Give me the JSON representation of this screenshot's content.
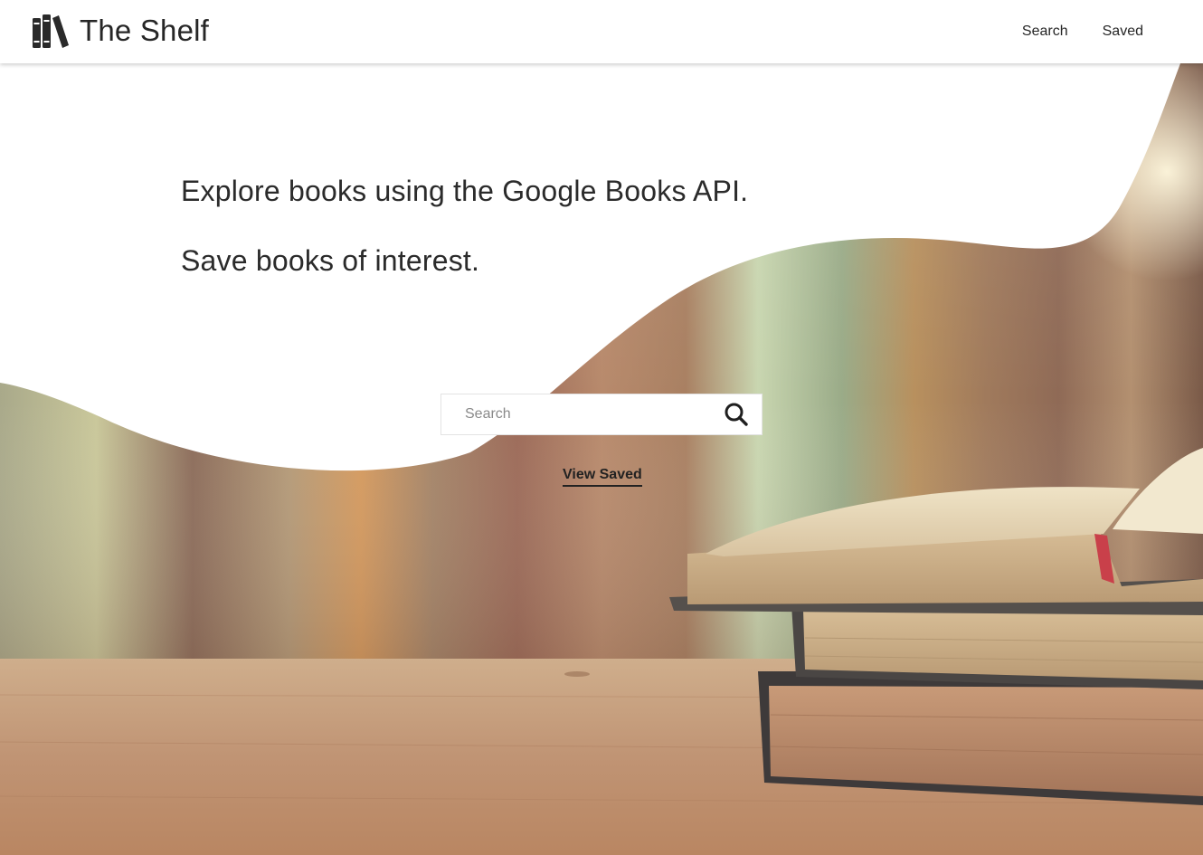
{
  "header": {
    "app_title": "The Shelf",
    "logo_icon": "bookshelf-icon",
    "nav": [
      {
        "label": "Search"
      },
      {
        "label": "Saved"
      }
    ]
  },
  "hero": {
    "headline": "Explore books using the Google Books API.",
    "subheadline": "Save books of interest.",
    "search": {
      "placeholder": "Search",
      "value": "",
      "icon": "search-icon"
    },
    "view_saved_label": "View Saved"
  },
  "colors": {
    "text": "#262626",
    "header_bg": "#ffffff"
  }
}
